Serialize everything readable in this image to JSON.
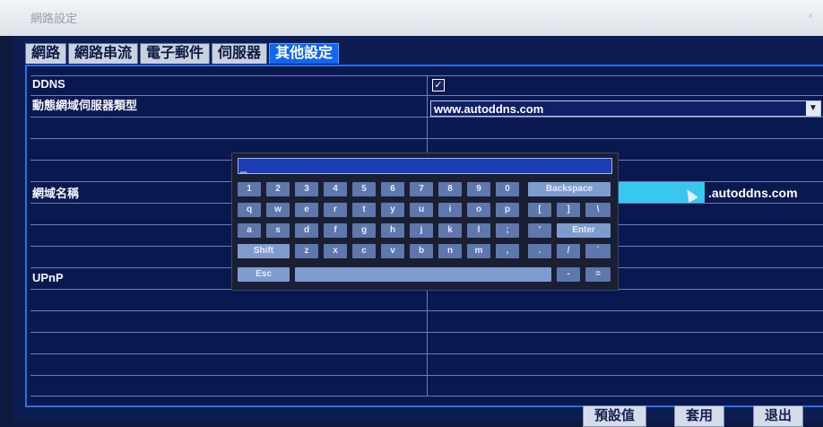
{
  "window": {
    "title": "網路設定",
    "close_glyph": "×"
  },
  "tabs": [
    {
      "label": "網路"
    },
    {
      "label": "網路串流"
    },
    {
      "label": "電子郵件"
    },
    {
      "label": "伺服器"
    },
    {
      "label": "其他設定"
    }
  ],
  "rows": {
    "ddns_label": "DDNS",
    "ddns_checked_glyph": "✓",
    "server_type_label": "動態網域伺服器類型",
    "server_type_value": "www.autoddns.com",
    "domain_label": "網域名稱",
    "domain_suffix": ".autoddns.com",
    "upnp_label": "UPnP"
  },
  "keyboard": {
    "input_value": "_",
    "row1": [
      "1",
      "2",
      "3",
      "4",
      "5",
      "6",
      "7",
      "8",
      "9",
      "0",
      "Backspace"
    ],
    "row2": [
      "q",
      "w",
      "e",
      "r",
      "t",
      "y",
      "u",
      "i",
      "o",
      "p",
      "[",
      "]",
      "\\"
    ],
    "row3": [
      "a",
      "s",
      "d",
      "f",
      "g",
      "h",
      "j",
      "k",
      "l",
      ";",
      "'",
      "Enter"
    ],
    "row4": [
      "Shift",
      "z",
      "x",
      "c",
      "v",
      "b",
      "n",
      "m",
      ",",
      ".",
      "/",
      "`"
    ],
    "row5": [
      "Esc",
      "",
      "-",
      "="
    ]
  },
  "footer": {
    "default_label": "預設值",
    "apply_label": "套用",
    "exit_label": "退出"
  },
  "colors": {
    "panel": "#0c1d52",
    "active_tab": "#1366f2",
    "highlight": "#38c8ef"
  }
}
